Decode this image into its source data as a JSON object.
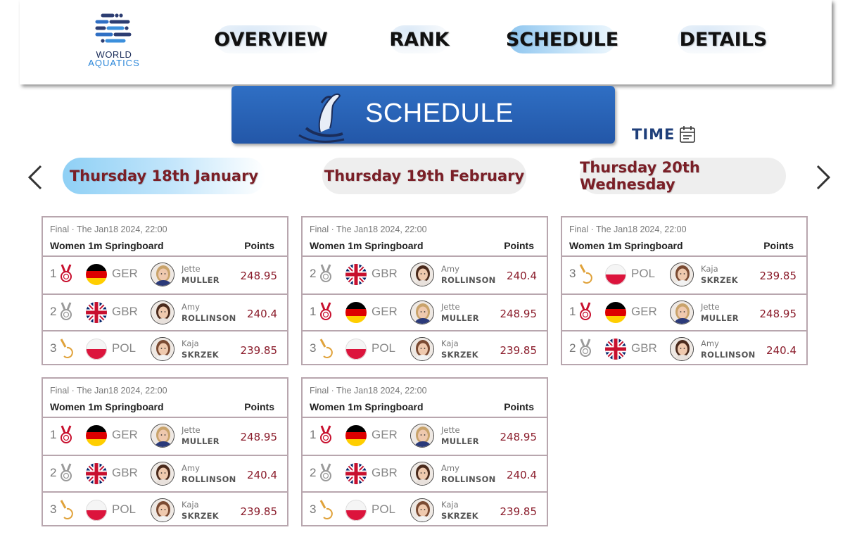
{
  "brand": {
    "line1": "WORLD",
    "line2": "AQUATICS"
  },
  "nav": [
    {
      "label": "OVERVIEW",
      "active": false
    },
    {
      "label": "RANK",
      "active": false
    },
    {
      "label": "SCHEDULE",
      "active": true
    },
    {
      "label": "DETAILS",
      "active": false
    }
  ],
  "banner": {
    "title": "SCHEDULE"
  },
  "time": {
    "label": "TIME"
  },
  "dates": [
    {
      "label": "Thursday 18th January",
      "active": true
    },
    {
      "label": "Thursday 19th February",
      "active": false
    },
    {
      "label": "Thursday 20th Wednesday",
      "active": false
    }
  ],
  "colors": {
    "accent": "#2357a8",
    "date_text": "#7a1f27",
    "points": "#8a1b2a",
    "card_border": "#b8a6ae"
  },
  "cards": [
    {
      "meta": "Final · The Jan18 2024, 22:00",
      "event": "Women 1m Springboard",
      "points_header": "Points",
      "rows": [
        {
          "pos": "1",
          "medal": "gold-medal-icon",
          "nat": "GER",
          "first": "Jette",
          "last": "MULLER",
          "points": "248.95"
        },
        {
          "pos": "2",
          "medal": "silver-medal-icon",
          "nat": "GBR",
          "first": "Amy",
          "last": "ROLLINSON",
          "points": "240.4"
        },
        {
          "pos": "3",
          "medal": "bronze-medal-icon",
          "nat": "POL",
          "first": "Kaja",
          "last": "SKRZEK",
          "points": "239.85"
        }
      ]
    },
    {
      "meta": "Final · The Jan18 2024, 22:00",
      "event": "Women 1m Springboard",
      "points_header": "Points",
      "rows": [
        {
          "pos": "2",
          "medal": "silver-medal-icon",
          "nat": "GBR",
          "first": "Amy",
          "last": "ROLLINSON",
          "points": "240.4"
        },
        {
          "pos": "1",
          "medal": "gold-medal-icon",
          "nat": "GER",
          "first": "Jette",
          "last": "MULLER",
          "points": "248.95"
        },
        {
          "pos": "3",
          "medal": "bronze-medal-icon",
          "nat": "POL",
          "first": "Kaja",
          "last": "SKRZEK",
          "points": "239.85"
        }
      ]
    },
    {
      "meta": "Final · The Jan18 2024, 22:00",
      "event": "Women 1m Springboard",
      "points_header": "Points",
      "rows": [
        {
          "pos": "3",
          "medal": "bronze-medal-icon",
          "nat": "POL",
          "first": "Kaja",
          "last": "SKRZEK",
          "points": "239.85"
        },
        {
          "pos": "1",
          "medal": "gold-medal-icon",
          "nat": "GER",
          "first": "Jette",
          "last": "MULLER",
          "points": "248.95"
        },
        {
          "pos": "2",
          "medal": "silver-medal-icon",
          "nat": "GBR",
          "first": "Amy",
          "last": "ROLLINSON",
          "points": "240.4"
        }
      ]
    },
    {
      "meta": "Final · The Jan18 2024, 22:00",
      "event": "Women 1m Springboard",
      "points_header": "Points",
      "rows": [
        {
          "pos": "1",
          "medal": "gold-medal-icon",
          "nat": "GER",
          "first": "Jette",
          "last": "MULLER",
          "points": "248.95"
        },
        {
          "pos": "2",
          "medal": "silver-medal-icon",
          "nat": "GBR",
          "first": "Amy",
          "last": "ROLLINSON",
          "points": "240.4"
        },
        {
          "pos": "3",
          "medal": "bronze-medal-icon",
          "nat": "POL",
          "first": "Kaja",
          "last": "SKRZEK",
          "points": "239.85"
        }
      ]
    },
    {
      "meta": "Final · The Jan18 2024, 22:00",
      "event": "Women 1m Springboard",
      "points_header": "Points",
      "rows": [
        {
          "pos": "1",
          "medal": "gold-medal-icon",
          "nat": "GER",
          "first": "Jette",
          "last": "MULLER",
          "points": "248.95"
        },
        {
          "pos": "2",
          "medal": "silver-medal-icon",
          "nat": "GBR",
          "first": "Amy",
          "last": "ROLLINSON",
          "points": "240.4"
        },
        {
          "pos": "3",
          "medal": "bronze-medal-icon",
          "nat": "POL",
          "first": "Kaja",
          "last": "SKRZEK",
          "points": "239.85"
        }
      ]
    }
  ]
}
